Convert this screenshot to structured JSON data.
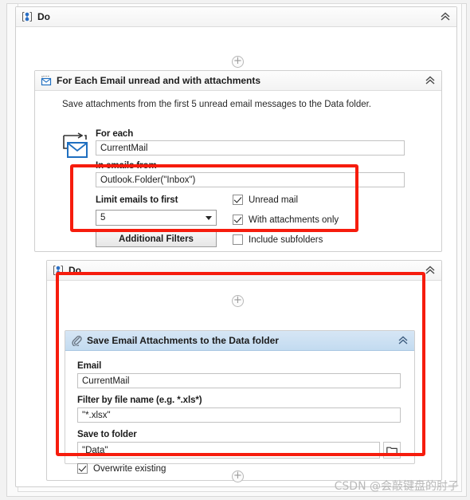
{
  "colors": {
    "annotation_red": "#f61c0d",
    "header_blue": "#c3dbf0",
    "panel_white": "#ffffff",
    "canvas_gray": "#f2f2f2"
  },
  "outer_do": {
    "title": "Do",
    "icon": "sequence-icon",
    "collapse_icon": "double-chevron-up-icon",
    "add_step_label": "+"
  },
  "for_each_email": {
    "title": "For Each Email unread and with attachments",
    "icon": "email-loop-icon",
    "collapse_icon": "double-chevron-up-icon",
    "description": "Save attachments from the first 5 unread email messages to the Data folder.",
    "for_each_label": "For each",
    "for_each_value": "CurrentMail",
    "in_emails_from_label": "In emails from",
    "in_emails_from_value": "Outlook.Folder(\"Inbox\")",
    "limit_label": "Limit emails to first",
    "limit_value": "5",
    "additional_filters_label": "Additional Filters",
    "checkboxes": [
      {
        "label": "Unread mail",
        "checked": true
      },
      {
        "label": "With attachments only",
        "checked": true
      },
      {
        "label": "Include subfolders",
        "checked": false
      }
    ]
  },
  "inner_do": {
    "title": "Do",
    "icon": "sequence-icon",
    "collapse_icon": "double-chevron-up-icon",
    "add_step_top_label": "+",
    "add_step_bottom_label": "+"
  },
  "save_attachments": {
    "title": "Save Email Attachments to the Data folder",
    "icon": "paperclip-icon",
    "collapse_icon": "double-chevron-up-icon",
    "email_label": "Email",
    "email_value": "CurrentMail",
    "filter_label": "Filter by file name (e.g. *.xls*)",
    "filter_value": "\"*.xlsx\"",
    "save_to_folder_label": "Save to folder",
    "save_to_folder_value": "\"Data\"",
    "browse_icon": "folder-icon",
    "overwrite_label": "Overwrite existing",
    "overwrite_checked": true
  },
  "watermark": {
    "text": "CSDN @会敲键盘的肘子"
  }
}
